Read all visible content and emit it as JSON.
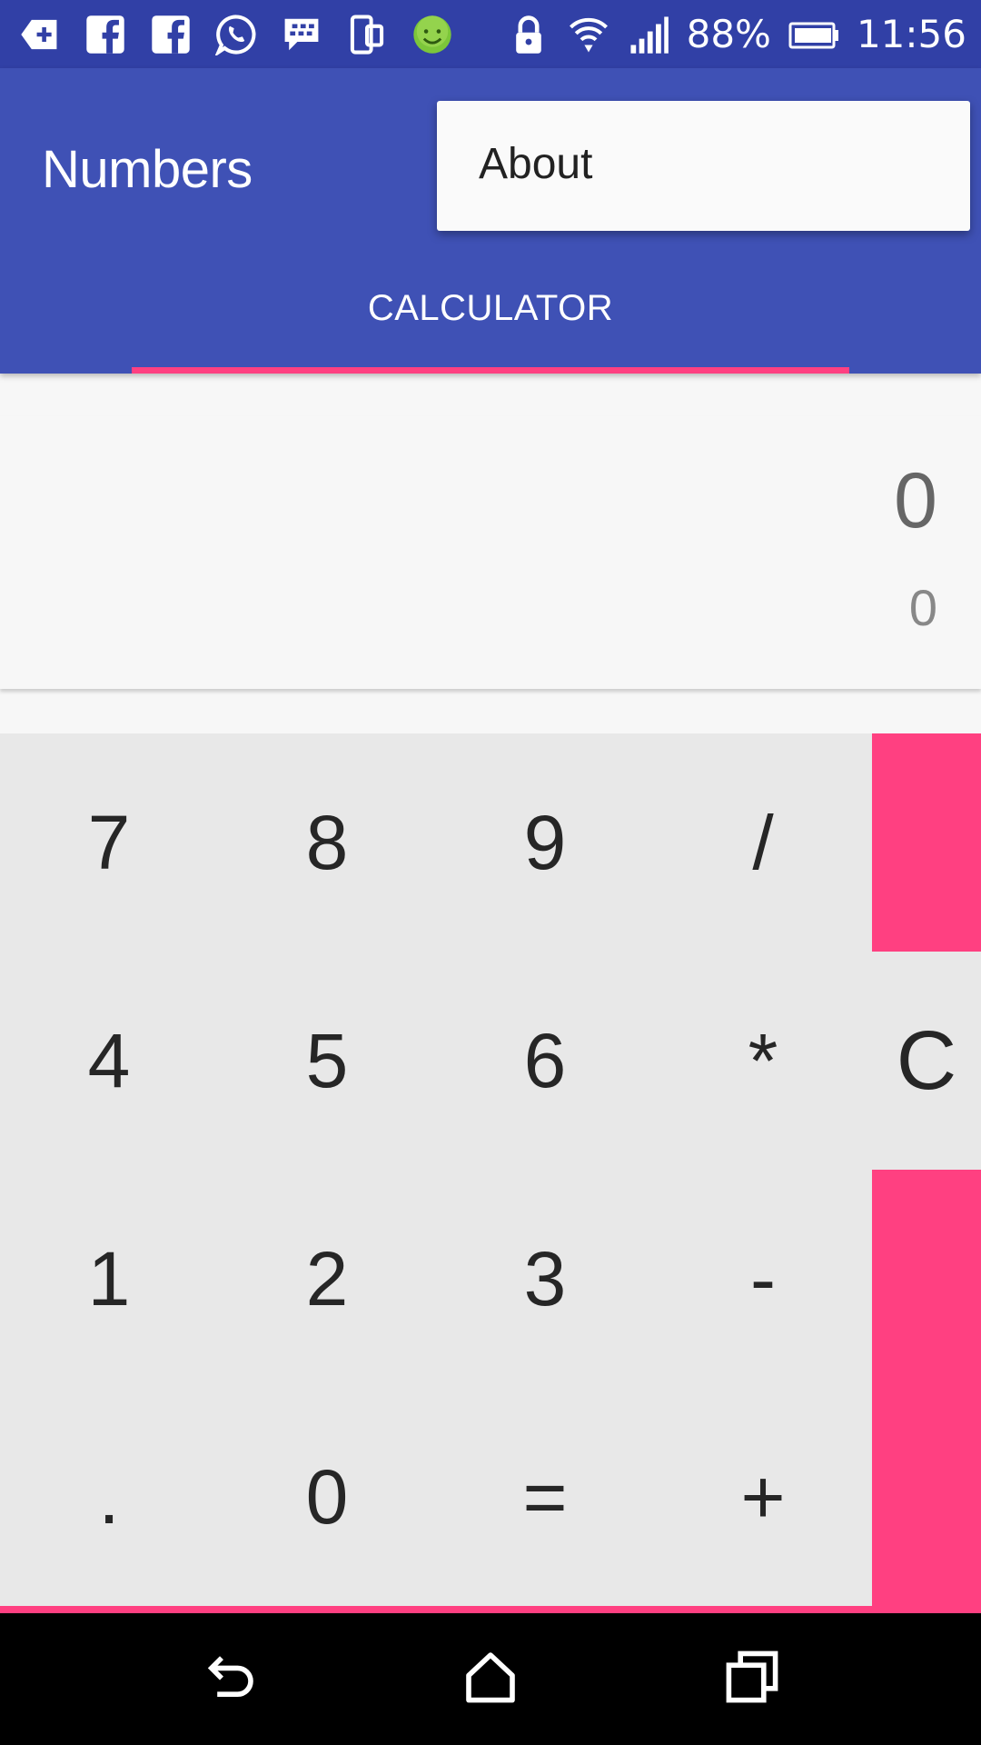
{
  "status_bar": {
    "battery_percent": "88%",
    "time": "11:56",
    "left_icons": [
      "notification-icon",
      "facebook-icon",
      "facebook-icon",
      "whatsapp-icon",
      "bbm-icon",
      "phone-icon",
      "smiley-icon"
    ],
    "right_icons": [
      "lock-icon",
      "wifi-icon",
      "signal-icon",
      "battery-icon"
    ]
  },
  "app_bar": {
    "title": "Numbers",
    "tab_label": "CALCULATOR"
  },
  "overflow_menu": {
    "items": [
      {
        "label": "About"
      }
    ]
  },
  "display": {
    "expression": "0",
    "result": "0"
  },
  "keypad": {
    "rows": [
      [
        "7",
        "8",
        "9",
        "/"
      ],
      [
        "4",
        "5",
        "6",
        "*"
      ],
      [
        "1",
        "2",
        "3",
        "-"
      ],
      [
        ".",
        "0",
        "=",
        "+"
      ]
    ],
    "clear_label": "C"
  },
  "colors": {
    "primary": "#3f51b5",
    "primary_dark": "#3140a6",
    "accent": "#ff4081",
    "keypad_bg": "#e8e8e8"
  },
  "nav_bar": {
    "icons": [
      "back-icon",
      "home-icon",
      "recents-icon"
    ]
  }
}
